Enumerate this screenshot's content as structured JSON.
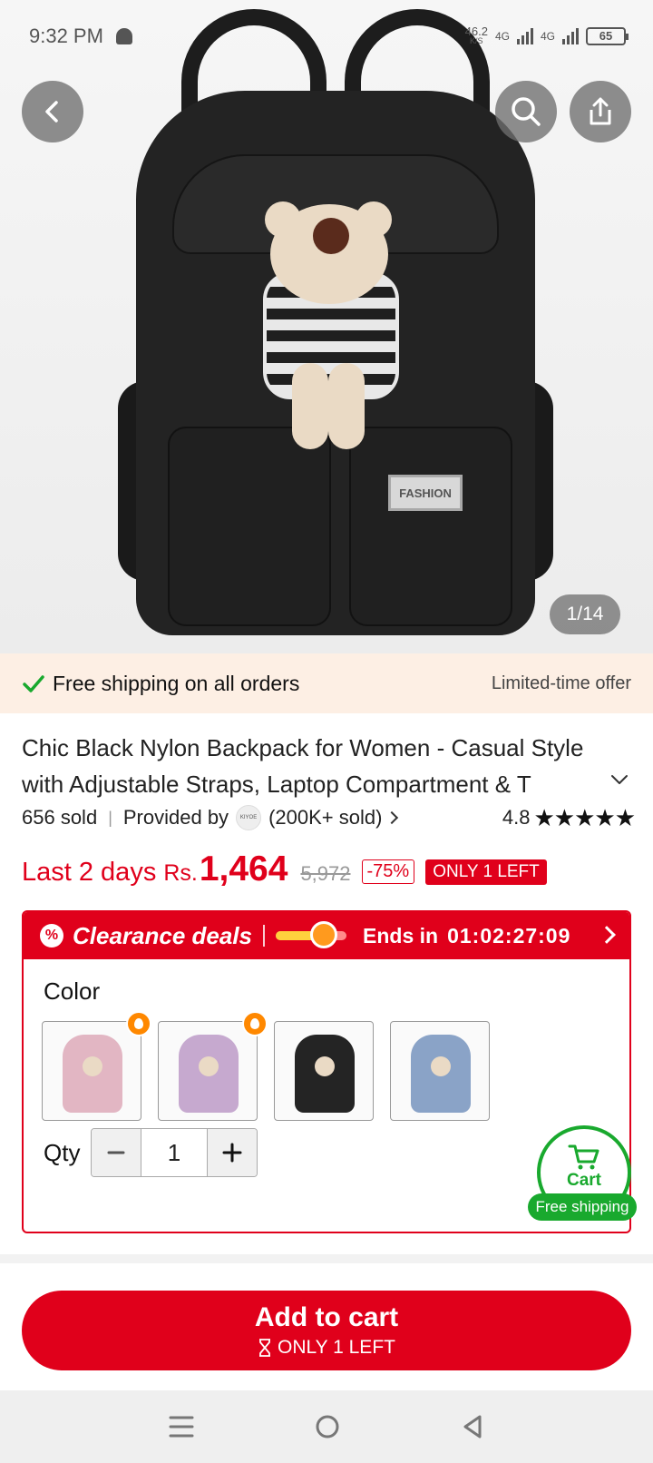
{
  "status_bar": {
    "time": "9:32 PM",
    "speed_value": "46.2",
    "speed_unit": "K/S",
    "network_1": "4G",
    "network_2": "4G",
    "battery": "65"
  },
  "gallery": {
    "counter": "1/14",
    "tag_text": "FASHION"
  },
  "shipping_bar": {
    "text": "Free shipping on all orders",
    "offer": "Limited-time offer"
  },
  "product": {
    "title": "Chic Black Nylon Backpack for Women - Casual Style with Adjustable Straps, Laptop Compartment & T",
    "sold": "656 sold",
    "provided_by": "Provided by",
    "store_logo": "KIYOE",
    "store_sold": "(200K+ sold)",
    "rating": "4.8",
    "stars": "★★★★★"
  },
  "price": {
    "promo_label": "Last 2 days",
    "currency": "Rs.",
    "current": "1,464",
    "original": "5,972",
    "discount": "-75%",
    "stock_badge": "ONLY 1 LEFT"
  },
  "clearance": {
    "title": "Clearance deals",
    "ends_label": "Ends in",
    "countdown": "01:02:27:09"
  },
  "options": {
    "color_label": "Color",
    "swatches": [
      {
        "color": "#e2b6c3",
        "hot": true
      },
      {
        "color": "#c6a9cf",
        "hot": true
      },
      {
        "color": "#242424",
        "hot": false
      },
      {
        "color": "#8aa3c7",
        "hot": false
      }
    ],
    "qty_label": "Qty",
    "qty_value": "1"
  },
  "cart_float": {
    "label": "Cart",
    "badge": "Free shipping"
  },
  "add_to_cart": {
    "label": "Add to cart",
    "sub_label": "ONLY 1 LEFT"
  },
  "colors": {
    "accent": "#e0001b",
    "green": "#19a92e"
  }
}
